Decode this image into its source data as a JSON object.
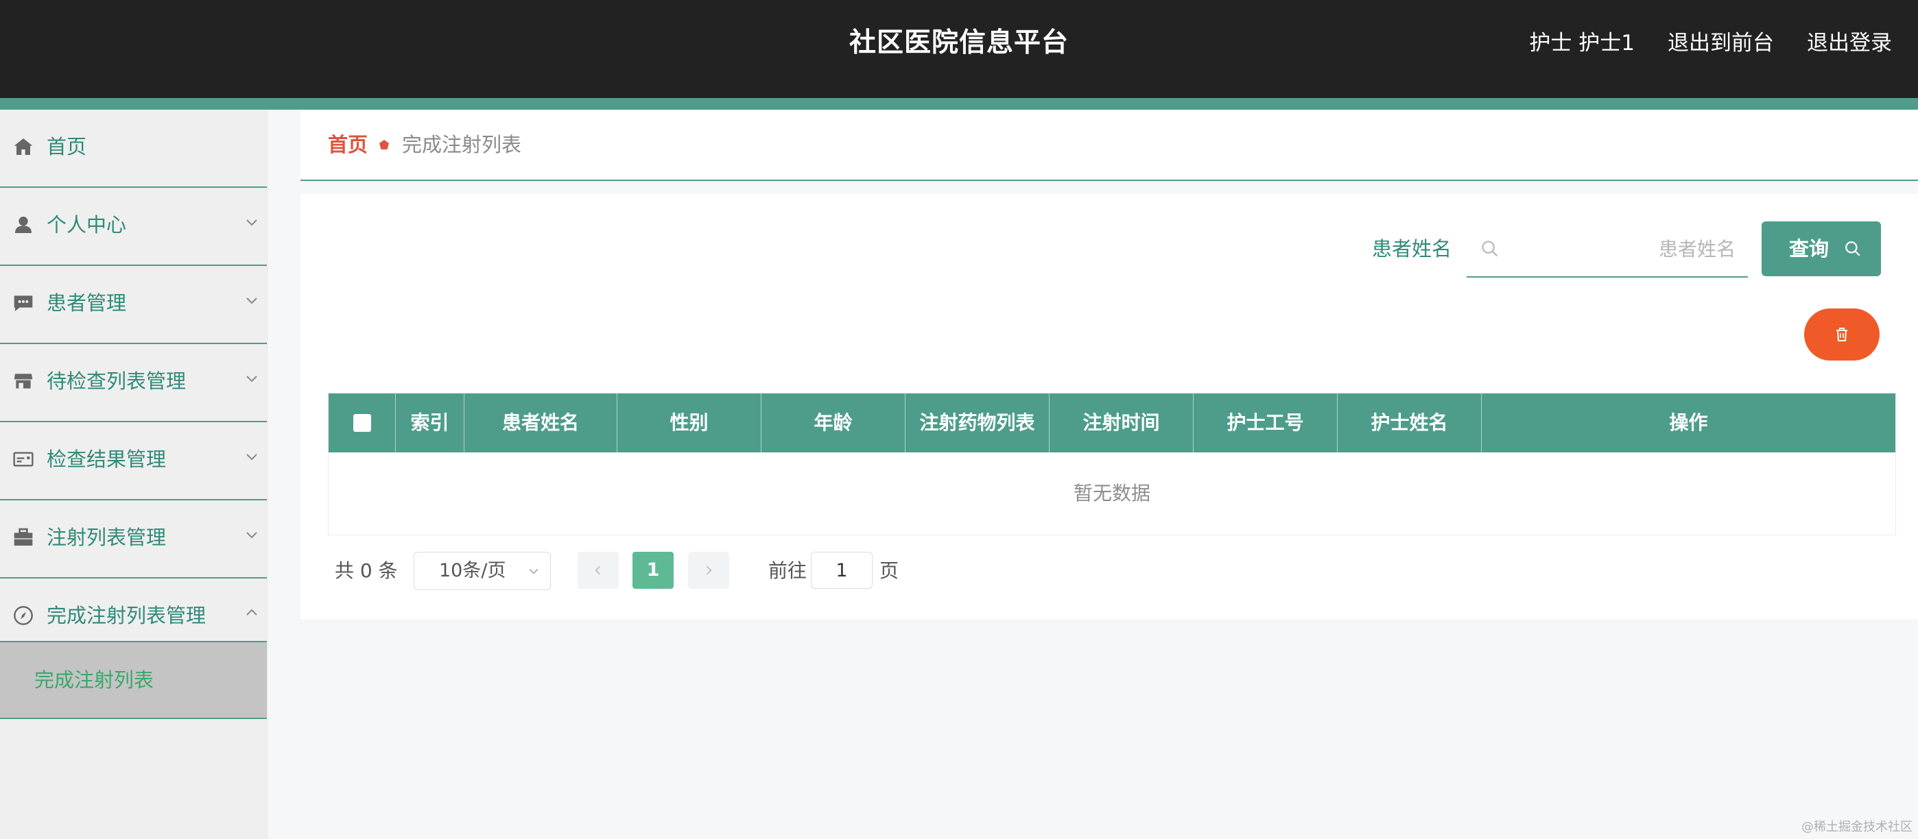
{
  "header": {
    "title": "社区医院信息平台",
    "links": [
      "护士 护士1",
      "退出到前台",
      "退出登录"
    ]
  },
  "sidebar": {
    "items": [
      {
        "label": "首页",
        "icon": "home-icon"
      },
      {
        "label": "个人中心",
        "icon": "user-icon"
      },
      {
        "label": "患者管理",
        "icon": "chat-icon"
      },
      {
        "label": "待检查列表管理",
        "icon": "shop-icon"
      },
      {
        "label": "检查结果管理",
        "icon": "card-icon"
      },
      {
        "label": "注射列表管理",
        "icon": "toolbox-icon"
      },
      {
        "label": "完成注射列表管理",
        "icon": "compass-icon",
        "expanded": true
      }
    ],
    "submenu": {
      "label": "完成注射列表"
    }
  },
  "breadcrumb": {
    "home": "首页",
    "current": "完成注射列表"
  },
  "search": {
    "label": "患者姓名",
    "placeholder": "患者姓名",
    "value": "",
    "button": "查询"
  },
  "table": {
    "columns": [
      "",
      "索引",
      "患者姓名",
      "性别",
      "年龄",
      "注射药物列表",
      "注射时间",
      "护士工号",
      "护士姓名",
      "操作"
    ],
    "rows": [],
    "empty_text": "暂无数据"
  },
  "pagination": {
    "total_text": "共 0 条",
    "page_size": "10条/页",
    "current_page": "1",
    "goto_label": "前往",
    "goto_value": "1",
    "page_unit": "页"
  },
  "colors": {
    "accent": "#4e9d8b",
    "header_bg": "#222222",
    "danger": "#f05a28",
    "breadcrumb_home": "#e0533e",
    "page_active": "#5dba94"
  },
  "watermark": "@稀土掘金技术社区"
}
